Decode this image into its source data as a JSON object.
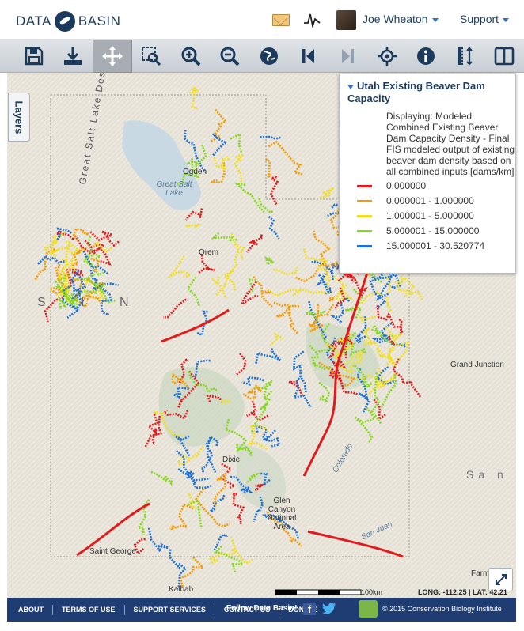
{
  "header": {
    "logo_left": "DATA",
    "logo_right": "BASIN",
    "user_name": "Joe Wheaton",
    "support_label": "Support",
    "icons": [
      "mail-icon",
      "activity-icon",
      "avatar"
    ]
  },
  "toolbar": {
    "buttons": [
      "save-icon",
      "download-icon",
      "pan-icon",
      "zoom-box-icon",
      "zoom-in-icon",
      "zoom-out-icon",
      "full-extent-icon",
      "previous-extent-icon",
      "next-extent-icon",
      "locate-icon",
      "info-icon",
      "measure-icon",
      "split-view-icon"
    ],
    "active": "pan-icon",
    "disabled": [
      "next-extent-icon"
    ]
  },
  "map": {
    "layers_tab": "Layers",
    "places": {
      "great_salt_lake_desert": "Great Salt Lake Desert",
      "great_salt_lake": "Great Salt Lake",
      "ogden": "Ogden",
      "orem": "Orem",
      "grand_junction": "Grand Junction",
      "st_george": "Saint George",
      "glen_canyon": "Glen Canyon National Area",
      "kaibab": "Kaibab",
      "dixie": "Dixie",
      "farmington": "Farm",
      "nevada_letters": "S I N",
      "san": "Sa n",
      "colorado": "Colorado",
      "san_juan": "San Juan"
    },
    "scale_label": "100km",
    "coords": "LONG: -112.25 | LAT: 42.21"
  },
  "legend": {
    "title": "Utah Existing Beaver Dam Capacity",
    "description": "Displaying:  Modeled Combined Existing Beaver Dam Capacity Density - Final FIS modeled output of existing beaver dam density based on all combined inputs [dams/km]",
    "items": [
      {
        "label": "0.000000",
        "color": "#e31a1c"
      },
      {
        "label": "0.000001 - 1.000000",
        "color": "#f59b00"
      },
      {
        "label": "1.000001 - 5.000000",
        "color": "#f2df1a"
      },
      {
        "label": "5.000001 - 15.000000",
        "color": "#86d81e"
      },
      {
        "label": "15.000001 - 30.520774",
        "color": "#1a6fd8"
      }
    ]
  },
  "footer": {
    "links": [
      "ABOUT",
      "TERMS OF USE",
      "SUPPORT SERVICES",
      "CONTACT US",
      "DONATE"
    ],
    "follow": "Follow Data Basin!",
    "facebook": "f",
    "copyright": "© 2015 Conservation Biology Institute"
  }
}
